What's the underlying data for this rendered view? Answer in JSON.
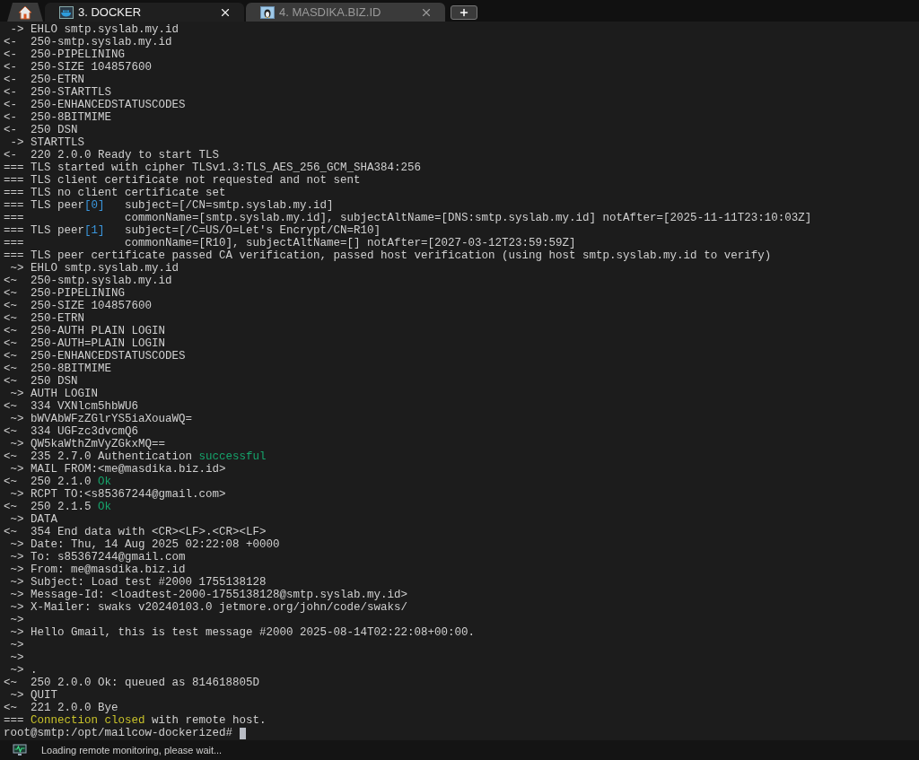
{
  "tabs": [
    {
      "kind": "home",
      "selected": false
    },
    {
      "kind": "docker",
      "label": "3. DOCKER",
      "selected": true
    },
    {
      "kind": "linux",
      "label": "4. MASDIKA.BIZ.ID",
      "selected": false
    }
  ],
  "lines": [
    {
      "segments": [
        {
          "text": " -> EHLO smtp.syslab.my.id"
        }
      ]
    },
    {
      "segments": [
        {
          "text": "<-  250-smtp.syslab.my.id"
        }
      ]
    },
    {
      "segments": [
        {
          "text": "<-  250-PIPELINING"
        }
      ]
    },
    {
      "segments": [
        {
          "text": "<-  250-SIZE 104857600"
        }
      ]
    },
    {
      "segments": [
        {
          "text": "<-  250-ETRN"
        }
      ]
    },
    {
      "segments": [
        {
          "text": "<-  250-STARTTLS"
        }
      ]
    },
    {
      "segments": [
        {
          "text": "<-  250-ENHANCEDSTATUSCODES"
        }
      ]
    },
    {
      "segments": [
        {
          "text": "<-  250-8BITMIME"
        }
      ]
    },
    {
      "segments": [
        {
          "text": "<-  250 DSN"
        }
      ]
    },
    {
      "segments": [
        {
          "text": " -> STARTTLS"
        }
      ]
    },
    {
      "segments": [
        {
          "text": "<-  220 2.0.0 Ready to start TLS"
        }
      ]
    },
    {
      "segments": [
        {
          "text": "=== TLS started with cipher TLSv1.3:TLS_AES_256_GCM_SHA384:256"
        }
      ]
    },
    {
      "segments": [
        {
          "text": "=== TLS client certificate not requested and not sent"
        }
      ]
    },
    {
      "segments": [
        {
          "text": "=== TLS no client certificate set"
        }
      ]
    },
    {
      "segments": [
        {
          "text": "=== TLS peer"
        },
        {
          "text": "[0]",
          "color": "#3a96dd"
        },
        {
          "text": "   subject=[/CN=smtp.syslab.my.id]"
        }
      ]
    },
    {
      "segments": [
        {
          "text": "===               commonName=[smtp.syslab.my.id], subjectAltName=[DNS:smtp.syslab.my.id] notAfter=[2025-11-11T23:10:03Z]"
        }
      ]
    },
    {
      "segments": [
        {
          "text": "=== TLS peer"
        },
        {
          "text": "[1]",
          "color": "#3a96dd"
        },
        {
          "text": "   subject=[/C=US/O=Let's Encrypt/CN=R10]"
        }
      ]
    },
    {
      "segments": [
        {
          "text": "===               commonName=[R10], subjectAltName=[] notAfter=[2027-03-12T23:59:59Z]"
        }
      ]
    },
    {
      "segments": [
        {
          "text": "=== TLS peer certificate passed CA verification, passed host verification (using host smtp.syslab.my.id to verify)"
        }
      ]
    },
    {
      "segments": [
        {
          "text": " ~> EHLO smtp.syslab.my.id"
        }
      ]
    },
    {
      "segments": [
        {
          "text": "<~  250-smtp.syslab.my.id"
        }
      ]
    },
    {
      "segments": [
        {
          "text": "<~  250-PIPELINING"
        }
      ]
    },
    {
      "segments": [
        {
          "text": "<~  250-SIZE 104857600"
        }
      ]
    },
    {
      "segments": [
        {
          "text": "<~  250-ETRN"
        }
      ]
    },
    {
      "segments": [
        {
          "text": "<~  250-AUTH PLAIN LOGIN"
        }
      ]
    },
    {
      "segments": [
        {
          "text": "<~  250-AUTH=PLAIN LOGIN"
        }
      ]
    },
    {
      "segments": [
        {
          "text": "<~  250-ENHANCEDSTATUSCODES"
        }
      ]
    },
    {
      "segments": [
        {
          "text": "<~  250-8BITMIME"
        }
      ]
    },
    {
      "segments": [
        {
          "text": "<~  250 DSN"
        }
      ]
    },
    {
      "segments": [
        {
          "text": " ~> AUTH LOGIN"
        }
      ]
    },
    {
      "segments": [
        {
          "text": "<~  334 VXNlcm5hbWU6"
        }
      ]
    },
    {
      "segments": [
        {
          "text": " ~> bWVAbWFzZGlrYS5iaXouaWQ="
        }
      ]
    },
    {
      "segments": [
        {
          "text": "<~  334 UGFzc3dvcmQ6"
        }
      ]
    },
    {
      "segments": [
        {
          "text": " ~> QW5kaWthZmVyZGkxMQ=="
        }
      ]
    },
    {
      "segments": [
        {
          "text": "<~  235 2.7.0 Authentication "
        },
        {
          "text": "successful",
          "color": "#16a36b"
        }
      ]
    },
    {
      "segments": [
        {
          "text": " ~> MAIL FROM:<me@masdika.biz.id>"
        }
      ]
    },
    {
      "segments": [
        {
          "text": "<~  250 2.1.0 "
        },
        {
          "text": "Ok",
          "color": "#16a36b"
        }
      ]
    },
    {
      "segments": [
        {
          "text": " ~> RCPT TO:<s85367244@gmail.com>"
        }
      ]
    },
    {
      "segments": [
        {
          "text": "<~  250 2.1.5 "
        },
        {
          "text": "Ok",
          "color": "#16a36b"
        }
      ]
    },
    {
      "segments": [
        {
          "text": " ~> DATA"
        }
      ]
    },
    {
      "segments": [
        {
          "text": "<~  354 End data with <CR><LF>.<CR><LF>"
        }
      ]
    },
    {
      "segments": [
        {
          "text": " ~> Date: Thu, 14 Aug 2025 02:22:08 +0000"
        }
      ]
    },
    {
      "segments": [
        {
          "text": " ~> To: s85367244@gmail.com"
        }
      ]
    },
    {
      "segments": [
        {
          "text": " ~> From: me@masdika.biz.id"
        }
      ]
    },
    {
      "segments": [
        {
          "text": " ~> Subject: Load test #2000 1755138128"
        }
      ]
    },
    {
      "segments": [
        {
          "text": " ~> Message-Id: <loadtest-2000-1755138128@smtp.syslab.my.id>"
        }
      ]
    },
    {
      "segments": [
        {
          "text": " ~> X-Mailer: swaks v20240103.0 jetmore.org/john/code/swaks/"
        }
      ]
    },
    {
      "segments": [
        {
          "text": " ~>"
        }
      ]
    },
    {
      "segments": [
        {
          "text": " ~> Hello Gmail, this is test message #2000 2025-08-14T02:22:08+00:00."
        }
      ]
    },
    {
      "segments": [
        {
          "text": " ~>"
        }
      ]
    },
    {
      "segments": [
        {
          "text": " ~>"
        }
      ]
    },
    {
      "segments": [
        {
          "text": " ~> ."
        }
      ]
    },
    {
      "segments": [
        {
          "text": "<~  250 2.0.0 Ok: queued as 814618805D"
        }
      ]
    },
    {
      "segments": [
        {
          "text": " ~> QUIT"
        }
      ]
    },
    {
      "segments": [
        {
          "text": "<~  221 2.0.0 Bye"
        }
      ]
    },
    {
      "segments": [
        {
          "text": "=== "
        },
        {
          "text": "Connection closed",
          "color": "#c8c22a"
        },
        {
          "text": " with remote host."
        }
      ]
    }
  ],
  "prompt": "root@smtp:/opt/mailcow-dockerized# ",
  "status_bar": {
    "text": "Loading remote monitoring, please wait..."
  }
}
